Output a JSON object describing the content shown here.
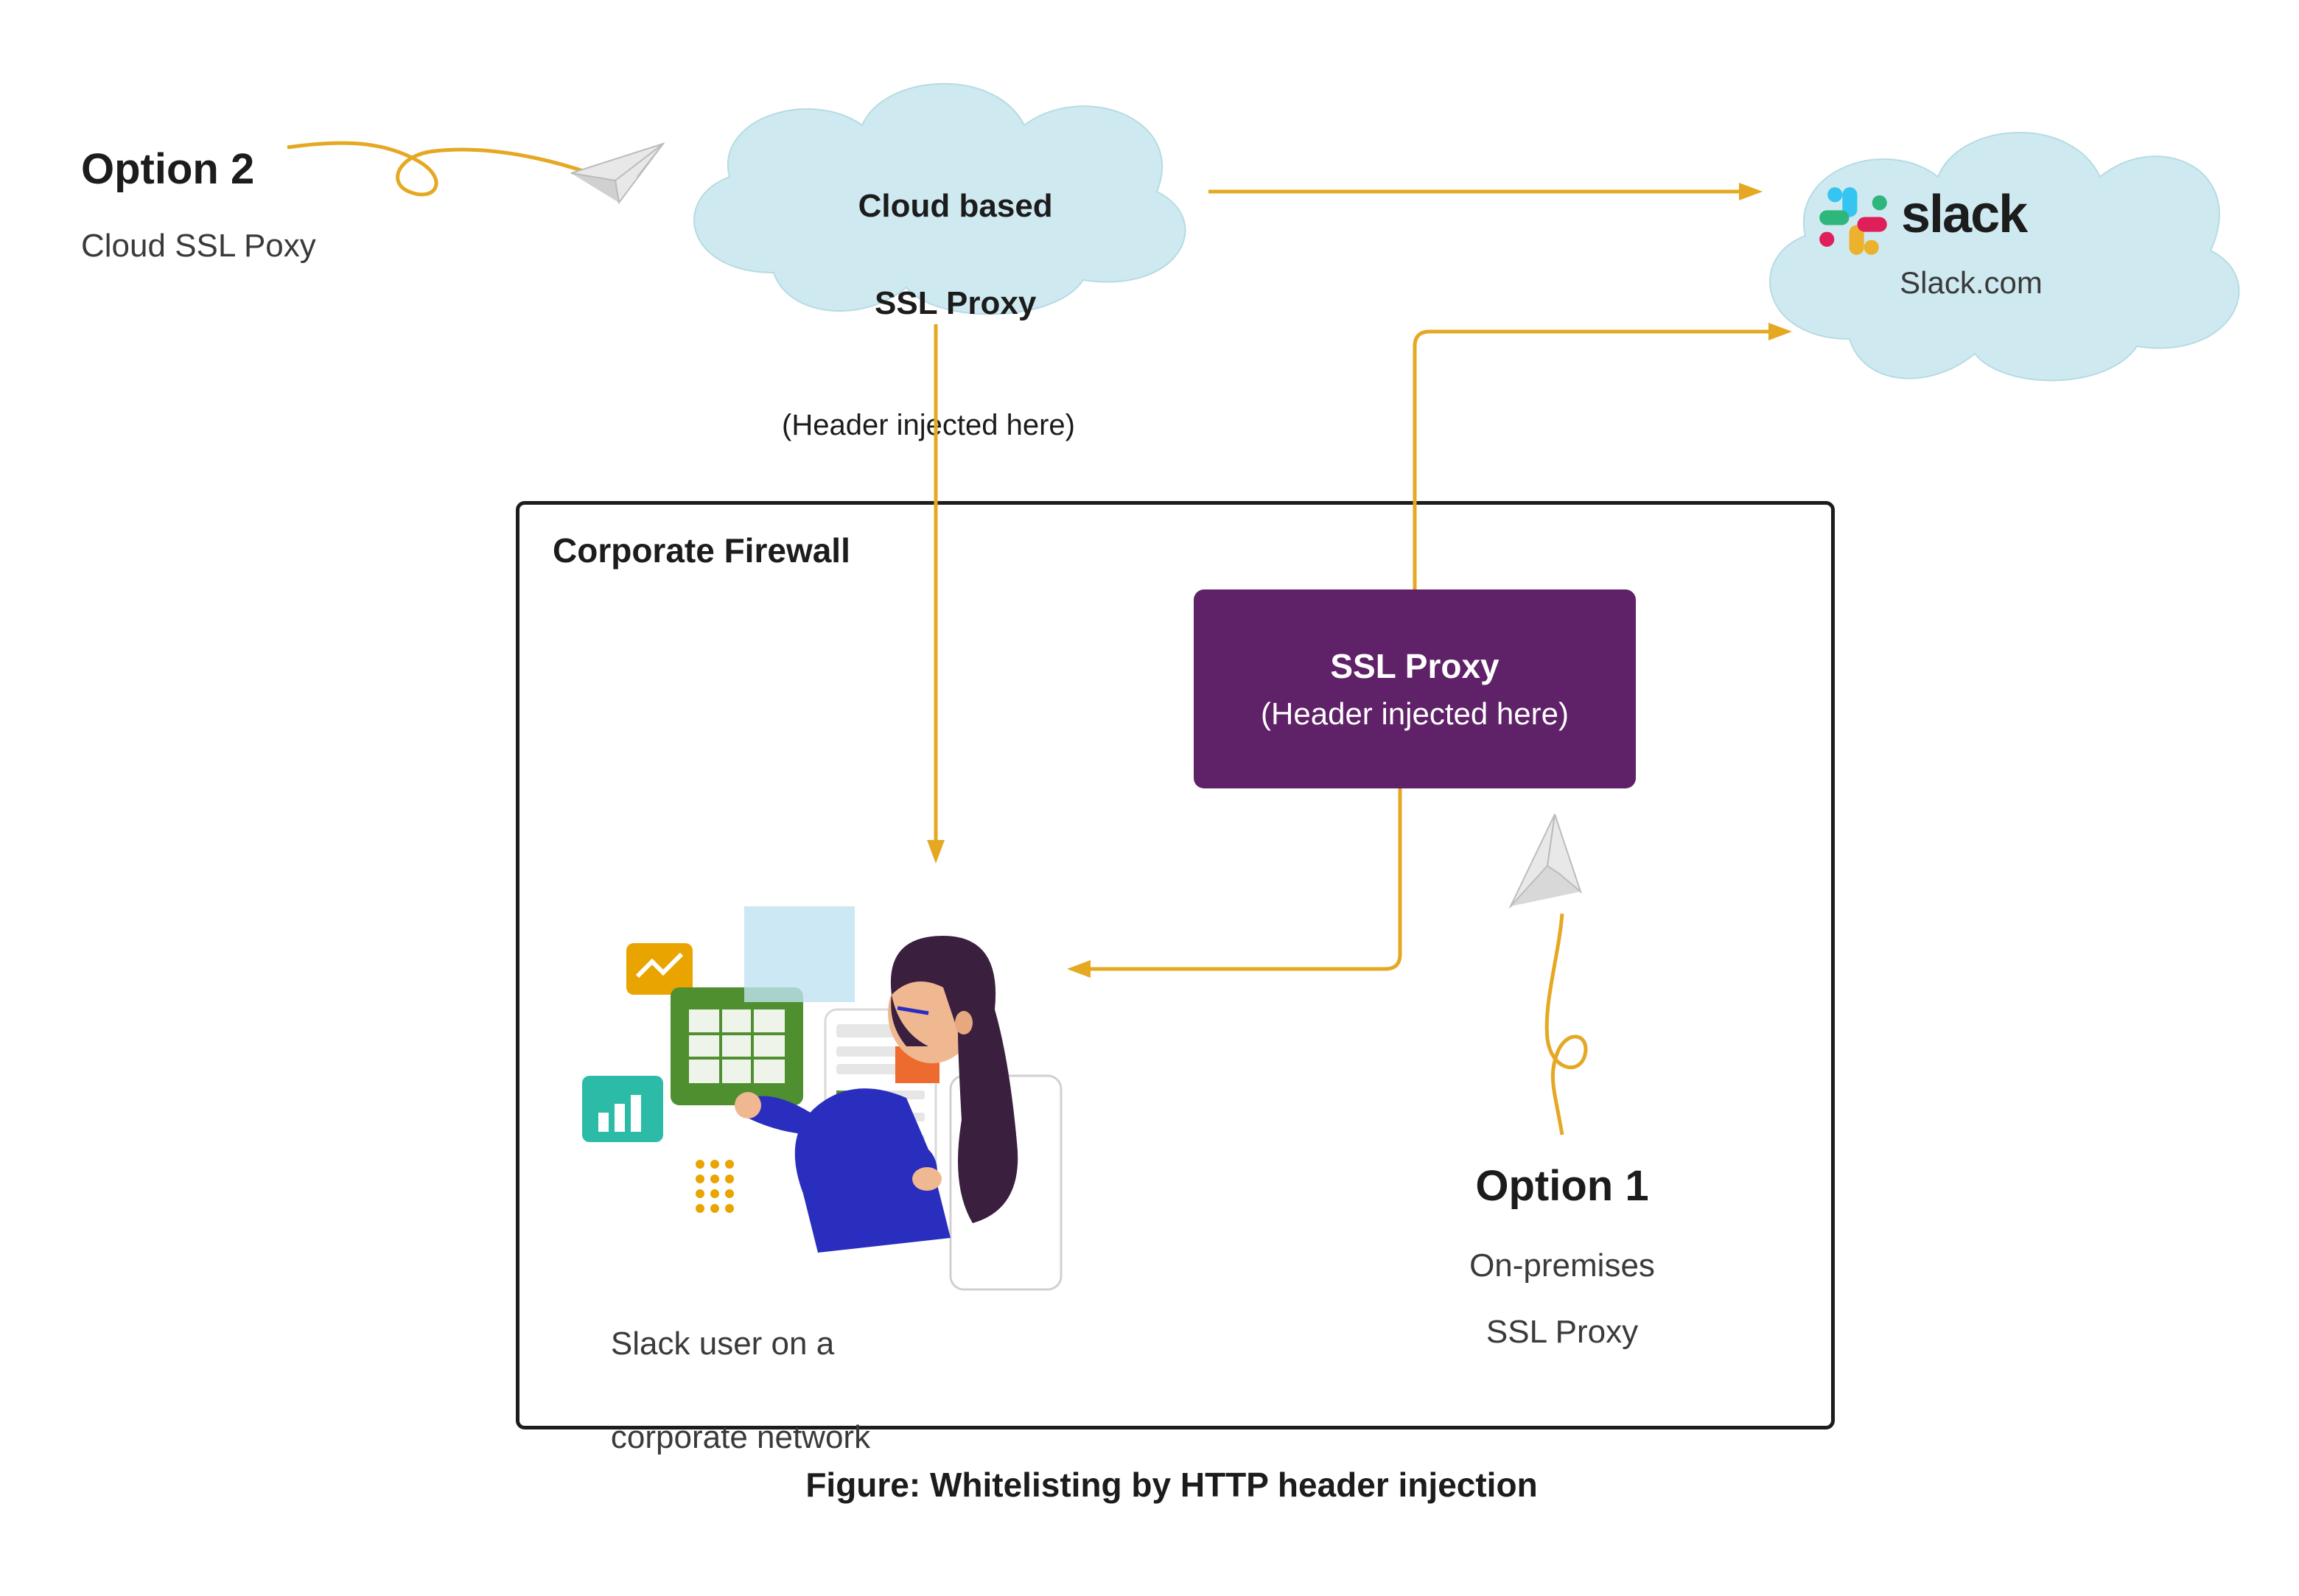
{
  "option2": {
    "title": "Option 2",
    "subtitle": "Cloud SSL Poxy"
  },
  "cloud_proxy": {
    "line1": "Cloud based",
    "line2": "SSL Proxy",
    "line3": "(Header injected here)"
  },
  "slack_cloud": {
    "brand": "slack",
    "domain": "Slack.com"
  },
  "firewall": {
    "title": "Corporate Firewall"
  },
  "ssl_box": {
    "line1": "SSL Proxy",
    "line2": "(Header injected here)"
  },
  "option1": {
    "title": "Option 1",
    "line1": "On-premises",
    "line2": "SSL Proxy"
  },
  "user": {
    "line1": "Slack user on a",
    "line2": "corporate network"
  },
  "caption": "Figure: Whitelisting by HTTP header injection"
}
